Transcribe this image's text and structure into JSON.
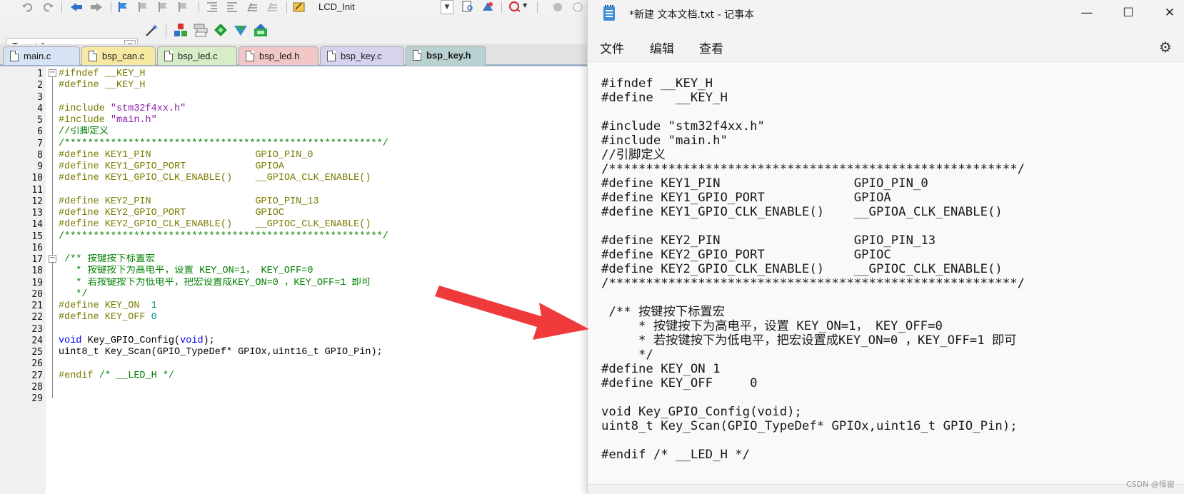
{
  "ide": {
    "function_selector": "LCD_Init",
    "target": "Target 1",
    "tabs": [
      {
        "label": "main.c",
        "color": "#d6e3f4"
      },
      {
        "label": "bsp_can.c",
        "color": "#f7e8a2"
      },
      {
        "label": "bsp_led.c",
        "color": "#d8ecc8"
      },
      {
        "label": "bsp_led.h",
        "color": "#f2c7c7"
      },
      {
        "label": "bsp_key.c",
        "color": "#d9d2ee"
      },
      {
        "label": "bsp_key.h",
        "color": "#b9d1d0"
      }
    ],
    "active_tab": "bsp_key.h",
    "line_numbers": [
      "1",
      "2",
      "3",
      "4",
      "5",
      "6",
      "7",
      "8",
      "9",
      "10",
      "11",
      "12",
      "13",
      "14",
      "15",
      "16",
      "17",
      "18",
      "19",
      "20",
      "21",
      "22",
      "23",
      "24",
      "25",
      "26",
      "27",
      "28",
      "29"
    ]
  },
  "notepad": {
    "title": "*新建 文本文档.txt - 记事本",
    "menu": [
      "文件",
      "编辑",
      "查看"
    ],
    "lines": [
      "#ifndef __KEY_H",
      "#define   __KEY_H",
      "",
      "#include \"stm32f4xx.h\"",
      "#include \"main.h\"",
      "//引脚定义",
      "/*******************************************************/",
      "#define KEY1_PIN                  GPIO_PIN_0",
      "#define KEY1_GPIO_PORT            GPIOA",
      "#define KEY1_GPIO_CLK_ENABLE()    __GPIOA_CLK_ENABLE()",
      "",
      "#define KEY2_PIN                  GPIO_PIN_13",
      "#define KEY2_GPIO_PORT            GPIOC",
      "#define KEY2_GPIO_CLK_ENABLE()    __GPIOC_CLK_ENABLE()",
      "/*******************************************************/",
      "",
      " /** 按键按下标置宏",
      "     * 按键按下为高电平，设置 KEY_ON=1， KEY_OFF=0",
      "     * 若按键按下为低电平，把宏设置成KEY_ON=0 ，KEY_OFF=1 即可",
      "     */",
      "#define KEY_ON 1",
      "#define KEY_OFF     0",
      "",
      "void Key_GPIO_Config(void);",
      "uint8_t Key_Scan(GPIO_TypeDef* GPIOx,uint16_t GPIO_Pin);",
      "",
      "#endif /* __LED_H */"
    ]
  },
  "watermark": "CSDN @怿窗",
  "colors": {
    "preprocessor": "#7a7a00",
    "string": "#8b1aa8",
    "comment": "#008000",
    "keyword": "#0000ee",
    "number": "#008b8b",
    "arrow": "#ee3a3a"
  },
  "icons": [
    "undo-icon",
    "redo-icon",
    "back-icon",
    "forward-icon",
    "bookmark-icon",
    "indent-icon",
    "unindent-icon",
    "comment-icon",
    "uncomment-icon",
    "open-file-icon",
    "find-icon",
    "debug-icon",
    "breakpoint-icon",
    "options-wand-icon",
    "translate-icon",
    "build-icon",
    "rebuild-icon",
    "download-icon",
    "manage-components-icon",
    "gear-icon"
  ]
}
